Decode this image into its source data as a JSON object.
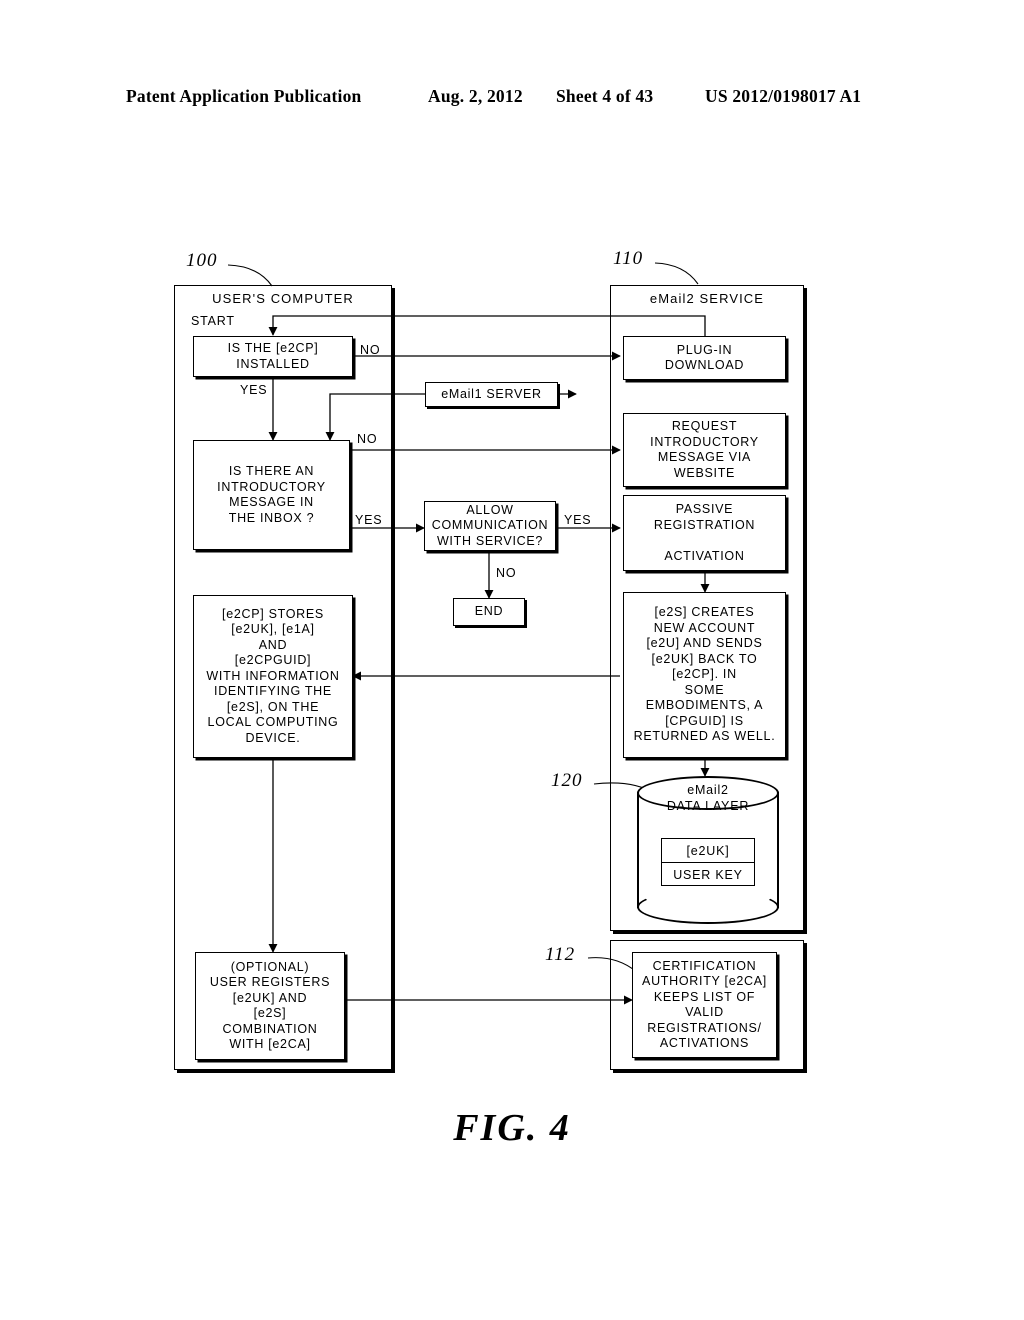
{
  "header": {
    "publication": "Patent Application Publication",
    "date": "Aug. 2, 2012",
    "sheet": "Sheet 4 of 43",
    "number": "US 2012/0198017 A1"
  },
  "figure": {
    "caption": "FIG.   4"
  },
  "panels": {
    "users_computer": {
      "ref": "100",
      "title": "USER'S  COMPUTER"
    },
    "email2_service": {
      "ref": "110",
      "title": "eMail2  SERVICE"
    },
    "certification_panel": {
      "ref": "112"
    },
    "data_layer": {
      "ref": "120"
    }
  },
  "nodes": {
    "start_label": "START",
    "is_e2cp_installed": "IS THE [e2CP]\nINSTALLED",
    "is_intro_message": "IS THERE AN\nINTRODUCTORY\nMESSAGE IN\nTHE INBOX ?",
    "e2cp_stores": "[e2CP] STORES\n[e2UK], [e1A]\nAND\n[e2CPGUID]\nWITH INFORMATION\nIDENTIFYING THE\n[e2S], ON THE\nLOCAL COMPUTING\nDEVICE.",
    "optional_user_registers": "(OPTIONAL)\nUSER REGISTERS\n[e2UK] AND\n[e2S]\nCOMBINATION\nWITH [e2CA]",
    "email1_server": "eMail1  SERVER",
    "allow_communication": "ALLOW\nCOMMUNICATION\nWITH  SERVICE?",
    "end": "END",
    "plugin_download": "PLUG-IN\nDOWNLOAD",
    "request_intro_message": "REQUEST\nINTRODUCTORY\nMESSAGE  VIA\nWEBSITE",
    "passive_registration": "PASSIVE\nREGISTRATION\n\nACTIVATION",
    "e2s_creates_account": "[e2S] CREATES\nNEW ACCOUNT\n[e2U] AND SENDS\n[e2UK] BACK TO\n[e2CP]. IN\nSOME\nEMBODIMENTS, A\n[CPGUID] IS\nRETURNED AS WELL.",
    "certification_authority": "CERTIFICATION\nAUTHORITY [e2CA]\nKEEPS LIST OF\nVALID\nREGISTRATIONS/\nACTIVATIONS",
    "data_layer_title": "eMail2\nDATA  LAYER",
    "data_layer_key_id": "[e2UK]",
    "data_layer_key_label": "USER  KEY"
  },
  "edge_labels": {
    "no_installed": "NO",
    "yes_installed": "YES",
    "no_intro": "NO",
    "yes_intro": "YES",
    "yes_allow": "YES",
    "no_allow": "NO"
  },
  "colors": {
    "ink": "#000000",
    "paper": "#ffffff"
  }
}
